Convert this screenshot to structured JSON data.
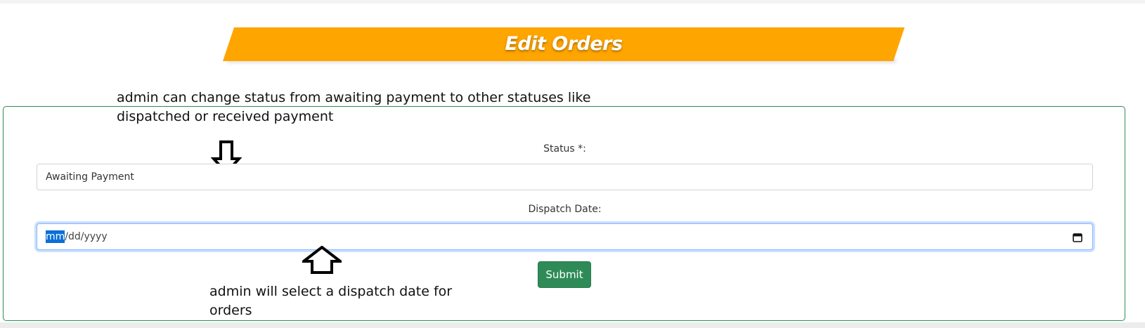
{
  "header": {
    "title": "Edit Orders",
    "banner_color": "#ffa500"
  },
  "annotations": {
    "status_note": "admin can change status from awaiting payment to other statuses like dispatched or received payment",
    "date_note": "admin will select a dispatch date for orders"
  },
  "form": {
    "border_color": "#2e8b57",
    "status": {
      "label": "Status *:",
      "value": "Awaiting Payment"
    },
    "dispatch_date": {
      "label": "Dispatch Date:",
      "placeholder_highlighted": "mm",
      "placeholder_rest": "/dd/yyyy",
      "icon": "calendar-icon"
    },
    "submit": {
      "label": "Submit",
      "color": "#2e8b57"
    }
  },
  "arrows": {
    "down": "arrow-down-icon",
    "up": "arrow-up-icon"
  }
}
